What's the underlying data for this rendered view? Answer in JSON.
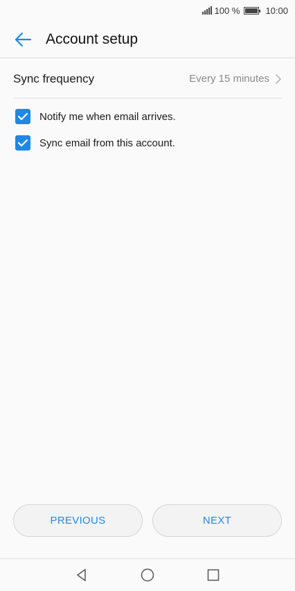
{
  "status_bar": {
    "battery": "100 %",
    "time": "10:00",
    "icons": [
      "signal-icon",
      "battery-icon"
    ]
  },
  "app_bar": {
    "title": "Account setup",
    "back_icon": "back-arrow-icon"
  },
  "sync": {
    "label": "Sync frequency",
    "value": "Every 15 minutes"
  },
  "options": [
    {
      "label": "Notify me when email arrives.",
      "checked": true
    },
    {
      "label": "Sync email from this account.",
      "checked": true
    }
  ],
  "buttons": {
    "previous": "PREVIOUS",
    "next": "NEXT"
  },
  "colors": {
    "accent": "#1e88e5",
    "background": "#fafafa"
  },
  "nav_bar": {
    "icons": [
      "back-triangle-icon",
      "home-circle-icon",
      "recents-square-icon"
    ]
  }
}
